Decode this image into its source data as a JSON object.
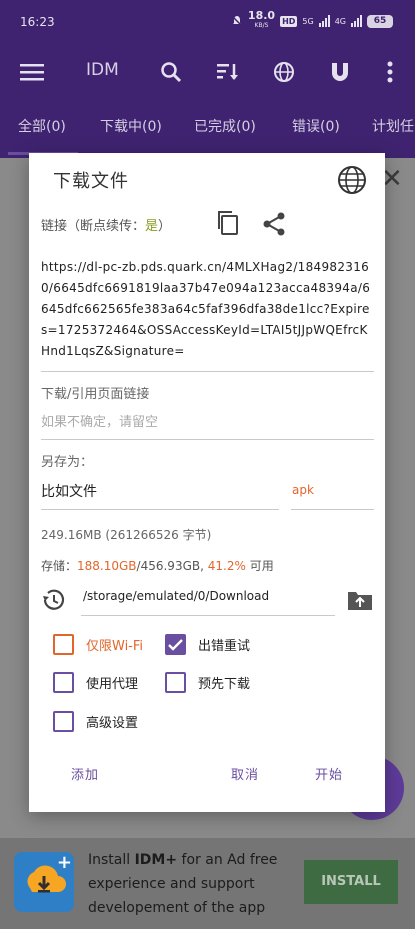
{
  "status": {
    "time": "16:23",
    "net_speed": "18.0",
    "net_unit": "KB/S",
    "hd": "HD",
    "net_5g": "5G",
    "net_4g": "4G",
    "battery": "65"
  },
  "appbar": {
    "title": "IDM",
    "icons": [
      "menu-icon",
      "search-icon",
      "sort-icon",
      "globe-icon",
      "magnet-icon",
      "more-vert-icon"
    ]
  },
  "tabs": [
    "全部(0)",
    "下载中(0)",
    "已完成(0)",
    "错误(0)",
    "计划任"
  ],
  "dialog": {
    "title": "下载文件",
    "link_label_prefix": "链接（断点续传：",
    "link_label_yes": "是",
    "link_label_suffix": "）",
    "url": "https://dl-pc-zb.pds.quark.cn/4MLXHag2/1849823160/6645dfc6691819laa37b47e094a123acca48394a/6645dfc662565fe383a64c5faf396dfa38de1lcc?Expires=1725372464&OSSAccessKeyId=LTAI5tJJpWQEfrcKHnd1LqsZ&Signature=",
    "ref_label": "下载/引用页面链接",
    "ref_placeholder": "如果不确定，请留空",
    "saveas_label": "另存为：",
    "filename": "比如文件",
    "extension": "apk",
    "size": "249.16MB (261266526 字节)",
    "storage_prefix": "存储：",
    "storage_free": "188.10GB",
    "storage_total": "/456.93GB, ",
    "storage_pct": "41.2%",
    "storage_suffix": " 可用",
    "path": "/storage/emulated/0/Download",
    "options": {
      "wifi_only": {
        "label": "仅限Wi-Fi",
        "checked": false
      },
      "retry_on_error": {
        "label": "出错重试",
        "checked": true
      },
      "use_proxy": {
        "label": "使用代理",
        "checked": false
      },
      "pre_download": {
        "label": "预先下载",
        "checked": false
      },
      "advanced": {
        "label": "高级设置",
        "checked": false
      }
    },
    "buttons": {
      "add": "添加",
      "cancel": "取消",
      "start": "开始"
    }
  },
  "ad": {
    "line1": "Install ",
    "brand": "IDM+",
    "line1_rest": " for an Ad free",
    "line2": "experience and support",
    "line3": "developement of the app",
    "install": "INSTALL"
  },
  "colors": {
    "primary": "#3f2370",
    "accent": "#6a4ea0",
    "orange": "#e2662c"
  }
}
